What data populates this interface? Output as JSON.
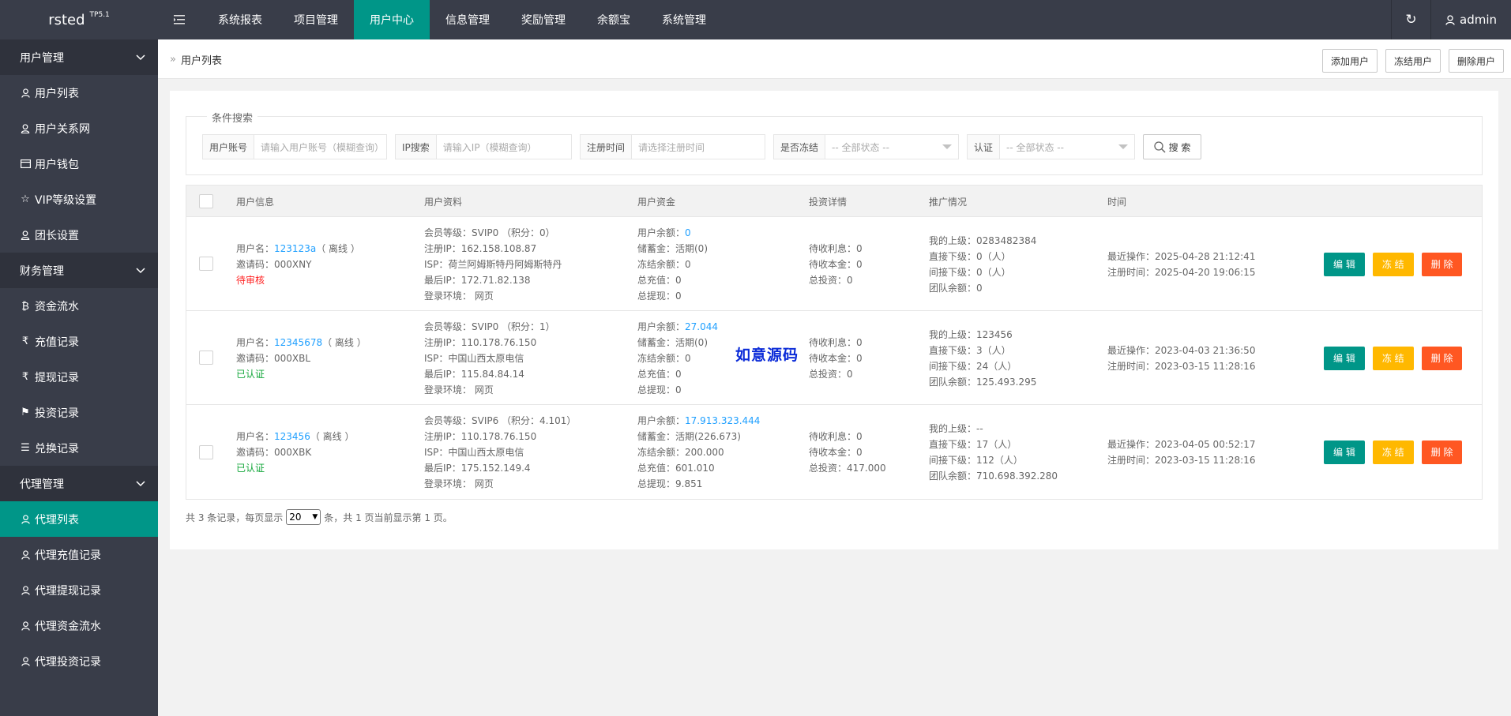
{
  "app": {
    "logo": "rsted",
    "version": "TP5.1"
  },
  "nav": {
    "items": [
      "系统报表",
      "项目管理",
      "用户中心",
      "信息管理",
      "奖励管理",
      "余额宝",
      "系统管理"
    ],
    "active_index": 2
  },
  "user": {
    "name": "admin"
  },
  "sidebar": {
    "groups": [
      {
        "label": "用户管理",
        "items": [
          {
            "label": "用户列表",
            "icon": "user-icon"
          },
          {
            "label": "用户关系网",
            "icon": "users-icon"
          },
          {
            "label": "用户钱包",
            "icon": "wallet-icon"
          },
          {
            "label": "VIP等级设置",
            "icon": "star-icon"
          },
          {
            "label": "团长设置",
            "icon": "users-icon"
          }
        ]
      },
      {
        "label": "财务管理",
        "items": [
          {
            "label": "资金流水",
            "icon": "bitcoin-icon"
          },
          {
            "label": "充值记录",
            "icon": "rupee-icon"
          },
          {
            "label": "提现记录",
            "icon": "rupee-icon"
          },
          {
            "label": "投资记录",
            "icon": "flag-icon"
          },
          {
            "label": "兑换记录",
            "icon": "list-icon"
          }
        ]
      },
      {
        "label": "代理管理",
        "items": [
          {
            "label": "代理列表",
            "icon": "user-icon",
            "active": true
          },
          {
            "label": "代理充值记录",
            "icon": "user-icon"
          },
          {
            "label": "代理提现记录",
            "icon": "user-icon"
          },
          {
            "label": "代理资金流水",
            "icon": "user-icon"
          },
          {
            "label": "代理投资记录",
            "icon": "user-icon"
          }
        ]
      }
    ]
  },
  "breadcrumb": {
    "sep": "»",
    "current": "用户列表"
  },
  "header_buttons": {
    "add": "添加用户",
    "freeze": "冻结用户",
    "delete": "删除用户"
  },
  "search": {
    "legend": "条件搜索",
    "account_label": "用户账号",
    "account_placeholder": "请输入用户账号（模糊查询）",
    "ip_label": "IP搜索",
    "ip_placeholder": "请输入IP（模糊查询）",
    "reg_label": "注册时间",
    "reg_placeholder": "请选择注册时间",
    "frozen_label": "是否冻结",
    "frozen_value": "-- 全部状态 --",
    "auth_label": "认证",
    "auth_value": "-- 全部状态 --",
    "button": "搜 索"
  },
  "table": {
    "headers": [
      "用户信息",
      "用户资料",
      "用户资金",
      "投资详情",
      "推广情况",
      "时间"
    ],
    "rows": [
      {
        "info": {
          "username_prefix": "用户名：",
          "username": "123123a",
          "online": "（ 离线 ）",
          "invite": "邀请码：000XNY",
          "status": "待审核",
          "status_type": "pending"
        },
        "profile": [
          "会员等级：SVIP0 （积分：0）",
          "注册IP：162.158.108.87",
          "ISP：荷兰阿姆斯特丹阿姆斯特丹",
          "最后IP：172.71.82.138",
          "登录环境：  网页"
        ],
        "funds": {
          "balance_label": "用户余额：",
          "balance": "0",
          "lines": [
            "储蓄金：活期(0)",
            "冻结余额：0",
            "总充值：0",
            "总提现：0"
          ]
        },
        "invest": [
          "待收利息：0",
          "待收本金：0",
          "总投资：0"
        ],
        "promo": [
          "我的上级：0283482384",
          "直接下级：0（人）",
          "间接下级：0（人）",
          "团队余额：0"
        ],
        "time": [
          "最近操作：2025-04-28 21:12:41",
          "注册时间：2025-04-20 19:06:15"
        ]
      },
      {
        "info": {
          "username_prefix": "用户名：",
          "username": "12345678",
          "online": "（ 离线 ）",
          "invite": "邀请码：000XBL",
          "status": "已认证",
          "status_type": "ok"
        },
        "profile": [
          "会员等级：SVIP0 （积分：1）",
          "注册IP：110.178.76.150",
          "ISP：中国山西太原电信",
          "最后IP：115.84.84.14",
          "登录环境：  网页"
        ],
        "funds": {
          "balance_label": "用户余额：",
          "balance": "27.044",
          "lines": [
            "储蓄金：活期(0)",
            "冻结余额：0",
            "总充值：0",
            "总提现：0"
          ]
        },
        "invest": [
          "待收利息：0",
          "待收本金：0",
          "总投资：0"
        ],
        "promo": [
          "我的上级：123456",
          "直接下级：3（人）",
          "间接下级：24（人）",
          "团队余额：125.493.295"
        ],
        "time": [
          "最近操作：2023-04-03 21:36:50",
          "注册时间：2023-03-15 11:28:16"
        ]
      },
      {
        "info": {
          "username_prefix": "用户名：",
          "username": "123456",
          "online": "（ 离线 ）",
          "invite": "邀请码：000XBK",
          "status": "已认证",
          "status_type": "ok"
        },
        "profile": [
          "会员等级：SVIP6 （积分：4.101）",
          "注册IP：110.178.76.150",
          "ISP：中国山西太原电信",
          "最后IP：175.152.149.4",
          "登录环境：  网页"
        ],
        "funds": {
          "balance_label": "用户余额：",
          "balance": "17.913.323.444",
          "lines": [
            "储蓄金：活期(226.673)",
            "冻结余额：200.000",
            "总充值：601.010",
            "总提现：9.851"
          ]
        },
        "invest": [
          "待收利息：0",
          "待收本金：0",
          "总投资：417.000"
        ],
        "promo": [
          "我的上级：--",
          "直接下级：17（人）",
          "间接下级：112（人）",
          "团队余额：710.698.392.280"
        ],
        "time": [
          "最近操作：2023-04-05 00:52:17",
          "注册时间：2023-03-15 11:28:16"
        ]
      }
    ],
    "actions": {
      "edit": "编 辑",
      "freeze": "冻 结",
      "delete": "删 除"
    }
  },
  "watermark": "如意源码",
  "pager": {
    "prefix": "共 3 条记录，每页显示",
    "per_page": "20",
    "suffix": "条，共 1 页当前显示第 1 页。"
  },
  "colors": {
    "topbar": "#393d49",
    "accent": "#009688",
    "warn": "#ffb800",
    "danger": "#ff5722",
    "link": "#1e9fff"
  }
}
